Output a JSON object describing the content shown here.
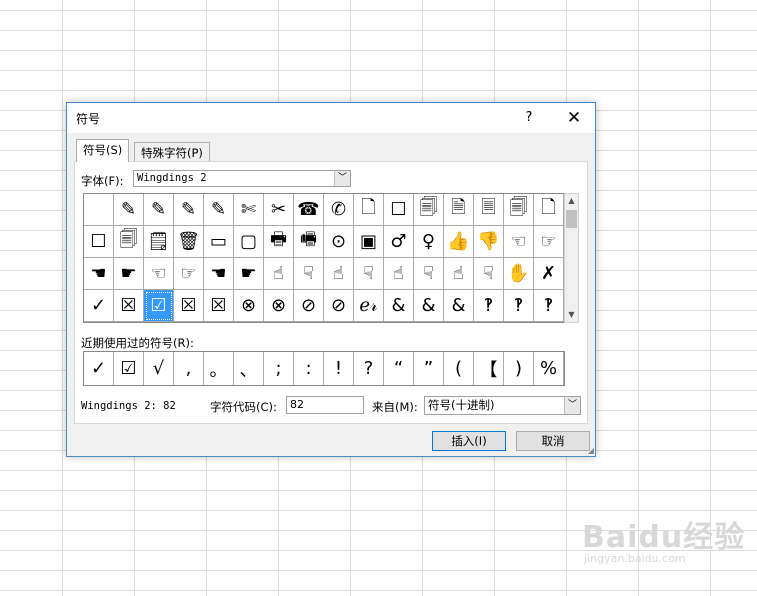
{
  "dialog": {
    "title": "符号",
    "help": "?",
    "close": "✕",
    "tabs": [
      {
        "label": "符号(S)"
      },
      {
        "label": "特殊字符(P)"
      }
    ],
    "font_label": "字体(F):",
    "font_value": "Wingdings 2",
    "combo_arrow": "﹀",
    "symbols": [
      "",
      "✎",
      "✎",
      "✎",
      "✎",
      "✄",
      "✂",
      "☎",
      "✆",
      "🗋",
      "☐",
      "🗐",
      "🗎",
      "🗏",
      "🗐",
      "🗋",
      "☐",
      "🗐",
      "🗒",
      "🗑",
      "▭",
      "▢",
      "🖶",
      "🖷",
      "⊙",
      "▣",
      "♂",
      "♀",
      "👍",
      "👎",
      "☜",
      "☞",
      "☚",
      "☛",
      "☜",
      "☞",
      "☚",
      "☛",
      "☝",
      "☟",
      "☝",
      "☟",
      "☝",
      "☟",
      "☝",
      "☟",
      "✋",
      "✗",
      "✓",
      "☒",
      "☑",
      "☒",
      "☒",
      "⊗",
      "⊗",
      "⊘",
      "⊘",
      "ℯ𝓇",
      "&",
      "&",
      "&",
      "‽",
      "‽",
      "‽"
    ],
    "selected_index": 50,
    "recent_label": "近期使用过的符号(R):",
    "recent": [
      "✓",
      "☑",
      "√",
      ",",
      "。",
      "、",
      ";",
      ":",
      "!",
      "?",
      "“",
      "”",
      "(",
      "【",
      ")",
      "%"
    ],
    "font_info": "Wingdings 2: 82",
    "code_label": "字符代码(C):",
    "code_value": "82",
    "from_label": "来自(M):",
    "from_value": "符号(十进制)",
    "insert_button": "插入(I)",
    "cancel_button": "取消"
  },
  "watermark": {
    "main": "Baidu经验",
    "sub": "jingyan.baidu.com"
  }
}
